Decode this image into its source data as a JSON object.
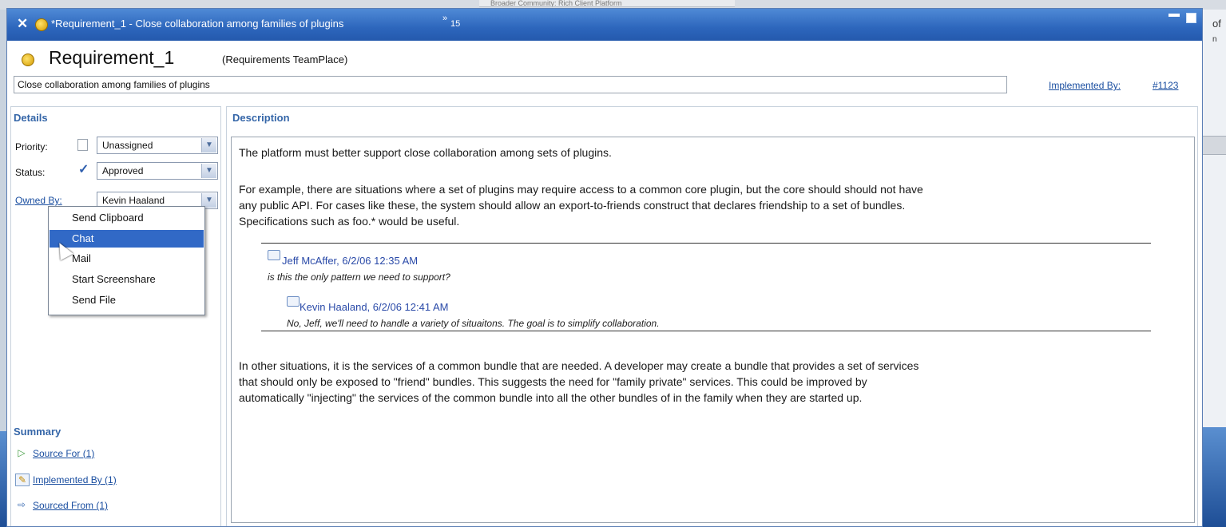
{
  "background": {
    "top_strip_text": "Broader Community: Rich Client Platform",
    "right_text_top": "of",
    "right_text_bottom": "n"
  },
  "window": {
    "title": "*Requirement_1 - Close collaboration among families of plugins",
    "overflow_count": "15",
    "overflow_glyph": "»"
  },
  "header": {
    "title": "Requirement_1",
    "team": "(Requirements TeamPlace)",
    "summary": "Close collaboration among families of plugins",
    "implemented_by_label": "Implemented By:",
    "implemented_by_link": "#1123"
  },
  "details": {
    "heading": "Details",
    "priority_label": "Priority:",
    "priority_value": "Unassigned",
    "status_label": "Status:",
    "status_value": "Approved",
    "owned_by_label": "Owned By:",
    "owned_by_value": "Kevin Haaland"
  },
  "context_menu": {
    "items": [
      "Send Clipboard",
      "Chat",
      "Mail",
      "Start Screenshare",
      "Send File"
    ],
    "highlighted": "Chat"
  },
  "summary": {
    "heading": "Summary",
    "items": [
      "Source For (1)",
      "Implemented By (1)",
      "Sourced From (1)"
    ]
  },
  "description": {
    "heading": "Description",
    "para1": "The platform must better support close collaboration among sets of plugins.",
    "para2_lines": [
      "For example, there are situations where a set of plugins may require access to a common core plugin, but the core should should not have",
      "any public API.  For cases like these, the system should allow an export-to-friends construct that declares friendship to a set of bundles.",
      "Specifications such as foo.* would be useful."
    ],
    "comments": [
      {
        "author": "Jeff McAffer, 6/2/06 12:35 AM",
        "text": "is this the only pattern we need to support?"
      },
      {
        "author": "Kevin Haaland, 6/2/06 12:41 AM",
        "text": "No, Jeff, we'll need to handle a variety of situaitons.  The goal is to simplify collaboration."
      }
    ],
    "para3_lines": [
      "In other situations, it is the services of a common bundle that are needed.  A developer may create a bundle that provides a set of services",
      "that should only be exposed to \"friend\" bundles.  This suggests the need for \"family private\" services.  This could be improved by",
      "automatically \"injecting\" the services of the common bundle into all the other bundles of in the family when they are started up."
    ]
  }
}
